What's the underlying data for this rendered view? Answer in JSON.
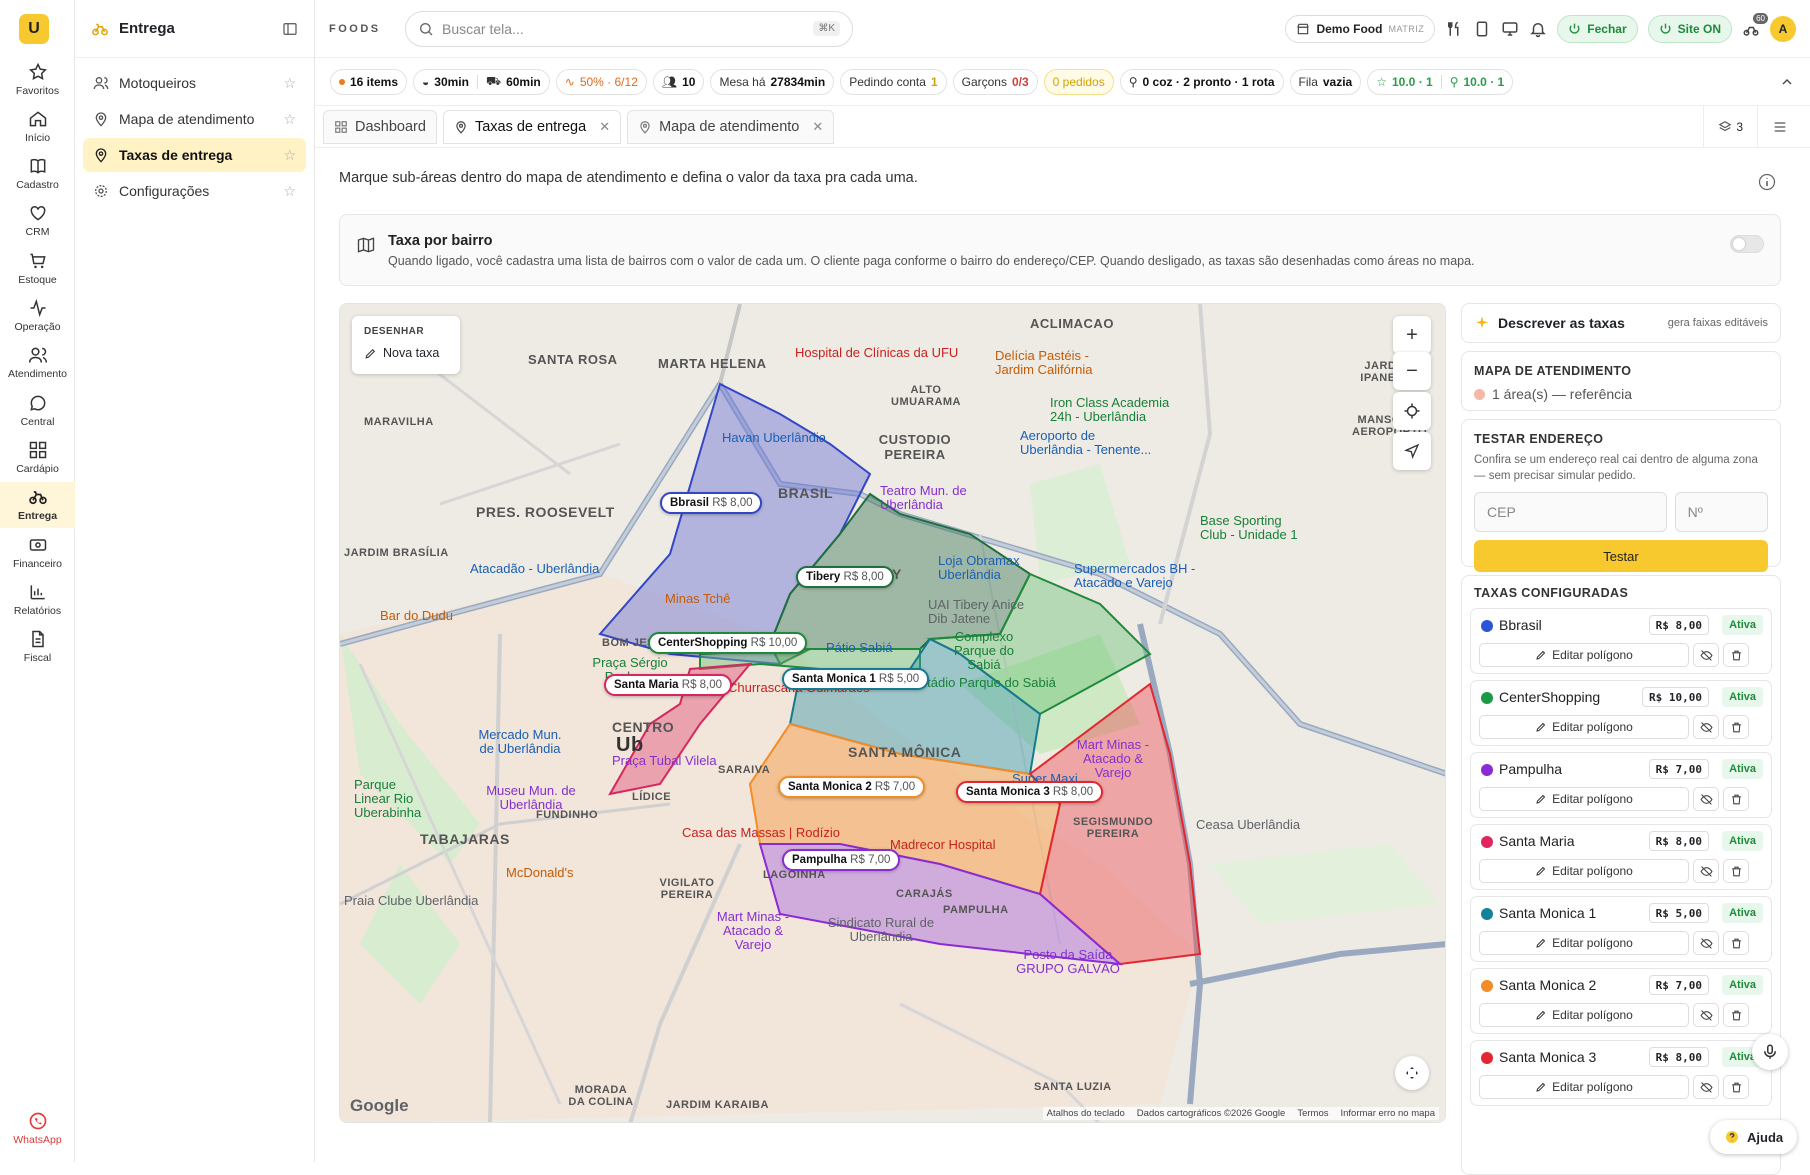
{
  "rail": {
    "items": [
      {
        "label": "Favoritos",
        "icon": "star-icon"
      },
      {
        "label": "Início",
        "icon": "home-icon"
      },
      {
        "label": "Cadastro",
        "icon": "book-icon"
      },
      {
        "label": "CRM",
        "icon": "heart-icon"
      },
      {
        "label": "Estoque",
        "icon": "cart-icon"
      },
      {
        "label": "Operação",
        "icon": "activity-icon"
      },
      {
        "label": "Atendimento",
        "icon": "users-icon"
      },
      {
        "label": "Central",
        "icon": "chat-icon"
      },
      {
        "label": "Cardápio",
        "icon": "grid-icon"
      },
      {
        "label": "Entrega",
        "icon": "bike-icon"
      },
      {
        "label": "Financeiro",
        "icon": "money-icon"
      },
      {
        "label": "Relatórios",
        "icon": "chart-icon"
      },
      {
        "label": "Fiscal",
        "icon": "file-icon"
      }
    ],
    "whatsapp": "WhatsApp",
    "active": "Entrega"
  },
  "sidebar": {
    "title": "Entrega",
    "items": [
      {
        "label": "Motoqueiros"
      },
      {
        "label": "Mapa de atendimento"
      },
      {
        "label": "Taxas de entrega"
      },
      {
        "label": "Configurações"
      }
    ]
  },
  "topbar": {
    "brand": "FOODS",
    "search_placeholder": "Buscar tela...",
    "search_shortcut": "⌘K",
    "store": "Demo Food",
    "store_tag": "MATRIZ",
    "close_label": "Fechar",
    "site_label": "Site ON",
    "badge": "60",
    "avatar": "A"
  },
  "stats": {
    "items": "16 items",
    "time1": "30min",
    "time2": "60min",
    "capacity": "50% · 6/12",
    "people": "10",
    "mesa_label": "Mesa há",
    "mesa_value": "27834min",
    "pedindo_label": "Pedindo conta",
    "pedindo_value": "1",
    "garcons_label": "Garçons",
    "garcons_value": "0/3",
    "pedidos": "0 pedidos",
    "kitchen": "0 coz · 2 pronto · 1 rota",
    "fila_label": "Fila",
    "fila_value": "vazia",
    "rating1": "10.0 · 1",
    "rating2": "10.0 · 1"
  },
  "tabs": [
    {
      "label": "Dashboard"
    },
    {
      "label": "Taxas de entrega"
    },
    {
      "label": "Mapa de atendimento"
    }
  ],
  "tabs_count": "3",
  "page": {
    "description": "Marque sub-áreas dentro do mapa de atendimento e defina o valor da taxa pra cada uma.",
    "bairro_title": "Taxa por bairro",
    "bairro_desc": "Quando ligado, você cadastra uma lista de bairros com o valor de cada um. O cliente paga conforme o bairro do endereço/CEP. Quando desligado, as taxas são desenhadas como áreas no mapa."
  },
  "map": {
    "draw_header": "DESENHAR",
    "draw_button": "Nova taxa",
    "google": "Google",
    "attribution": [
      "Atalhos do teclado",
      "Dados cartográficos ©2026 Google",
      "Termos",
      "Informar erro no mapa"
    ],
    "neighborhoods": [
      "SANTA ROSA",
      "MARTA HELENA",
      "ACLIMACAO",
      "PRES. ROOSEVELT",
      "BRASIL",
      "CUSTODIO PEREIRA",
      "ALTO UMUARAMA",
      "TIBERY",
      "SANTA MÔNICA",
      "CENTRO",
      "TABAJARAS",
      "FUNDINHO",
      "LÍDICE",
      "SARAIVA",
      "LAGOINHA",
      "CARAJÁS",
      "PAMPULHA",
      "SEGISMUNDO PEREIRA",
      "VIGILATO PEREIRA",
      "JARDIM KARAIBA",
      "MORADA DA COLINA",
      "SANTA LUZIA",
      "BOM JESUS",
      "MARAVILHA",
      "JARDIM IPANEMA",
      "MANSOES AEROPORTO",
      "JARDIM BRASÍLIA",
      "Ub"
    ],
    "pois": [
      "Hospital de Clínicas da UFU",
      "Delícia Pastéis - Jardim Califórnia",
      "Iron Class Academia 24h - Uberlândia",
      "Aeroporto de Uberlândia - Tenente...",
      "Havan Uberlândia",
      "Teatro Mun. de Uberlândia",
      "Base Sporting Club - Unidade 1",
      "Atacadão - Uberlândia",
      "Loja Obramax Uberlândia",
      "Supermercados BH - Atacado e Varejo",
      "Minas Tchê",
      "UAI Tibery Anice Dib Jatene",
      "Bar do Dudu",
      "Complexo Parque do Sabiá",
      "Pátio Sabiá",
      "Praça Sérgio Pacheco",
      "Estádio Parque do Sabiá",
      "Churrascaria Guimarães",
      "Mercado Mun. de Uberlândia",
      "Praça Tubal Vilela",
      "Mart Minas - Atacado & Varejo",
      "Super Maxi",
      "Parque Linear Rio Uberabinha",
      "Museu Mun. de Uberlândia",
      "Ceasa Uberlândia",
      "Casa das Massas | Rodízio",
      "Madrecor Hospital",
      "McDonald's",
      "Praia Clube Uberlândia",
      "Sindicato Rural de Uberlândia",
      "Posto da Saída GRUPO GALVÃO"
    ],
    "zones": [
      {
        "name": "Bbrasil",
        "price": "R$ 8,00",
        "color": "#3b4cc0"
      },
      {
        "name": "Tibery",
        "price": "R$ 8,00",
        "color": "#1f6f3f"
      },
      {
        "name": "CenterShopping",
        "price": "R$ 10,00",
        "color": "#1f8a3b"
      },
      {
        "name": "Santa Maria",
        "price": "R$ 8,00",
        "color": "#d6285e"
      },
      {
        "name": "Santa Monica 1",
        "price": "R$ 5,00",
        "color": "#167a8f"
      },
      {
        "name": "Santa Monica 2",
        "price": "R$ 7,00",
        "color": "#f28c28"
      },
      {
        "name": "Santa Monica 3",
        "price": "R$ 8,00",
        "color": "#e3262f"
      },
      {
        "name": "Pampulha",
        "price": "R$ 7,00",
        "color": "#8a2bd6"
      }
    ]
  },
  "panel": {
    "describe_title": "Descrever as taxas",
    "describe_hint": "gera faixas editáveis",
    "area_title": "MAPA DE ATENDIMENTO",
    "area_text": "1 área(s) — referência",
    "test_title": "TESTAR ENDEREÇO",
    "test_desc": "Confira se um endereço real cai dentro de alguma zona — sem precisar simular pedido.",
    "cep_placeholder": "CEP",
    "num_placeholder": "Nº",
    "test_button": "Testar",
    "fees_title": "TAXAS CONFIGURADAS",
    "edit_label": "Editar polígono",
    "status_label": "Ativa",
    "fees": [
      {
        "name": "Bbrasil",
        "price": "R$ 8,00",
        "color": "#2b54d6"
      },
      {
        "name": "CenterShopping",
        "price": "R$ 10,00",
        "color": "#1c9a45"
      },
      {
        "name": "Pampulha",
        "price": "R$ 7,00",
        "color": "#8a2bd6"
      },
      {
        "name": "Santa Maria",
        "price": "R$ 8,00",
        "color": "#e0265f"
      },
      {
        "name": "Santa Monica 1",
        "price": "R$ 5,00",
        "color": "#13829a"
      },
      {
        "name": "Santa Monica 2",
        "price": "R$ 7,00",
        "color": "#f28c28"
      },
      {
        "name": "Santa Monica 3",
        "price": "R$ 8,00",
        "color": "#e3262f"
      }
    ]
  },
  "help_label": "Ajuda"
}
